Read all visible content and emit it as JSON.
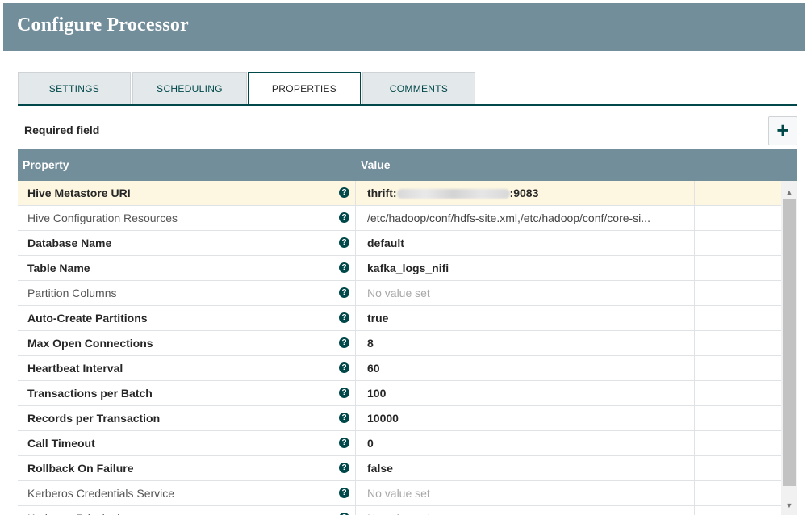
{
  "window": {
    "title": "Configure Processor"
  },
  "tabs": [
    {
      "label": "SETTINGS"
    },
    {
      "label": "SCHEDULING"
    },
    {
      "label": "PROPERTIES"
    },
    {
      "label": "COMMENTS"
    }
  ],
  "active_tab": "PROPERTIES",
  "required_label": "Required field",
  "add_button": {
    "label": "+"
  },
  "table": {
    "headers": {
      "property": "Property",
      "value": "Value"
    },
    "rows": [
      {
        "name": "Hive Metastore URI",
        "required": true,
        "value_prefix": "thrift:",
        "value_suffix": ":9083",
        "value_state": "set"
      },
      {
        "name": "Hive Configuration Resources",
        "required": false,
        "value": "/etc/hadoop/conf/hdfs-site.xml,/etc/hadoop/conf/core-si...",
        "value_state": "set"
      },
      {
        "name": "Database Name",
        "required": true,
        "value": "default",
        "value_state": "set"
      },
      {
        "name": "Table Name",
        "required": true,
        "value": "kafka_logs_nifi",
        "value_state": "set"
      },
      {
        "name": "Partition Columns",
        "required": false,
        "value": "No value set",
        "value_state": "empty"
      },
      {
        "name": "Auto-Create Partitions",
        "required": true,
        "value": "true",
        "value_state": "set"
      },
      {
        "name": "Max Open Connections",
        "required": true,
        "value": "8",
        "value_state": "set"
      },
      {
        "name": "Heartbeat Interval",
        "required": true,
        "value": "60",
        "value_state": "set"
      },
      {
        "name": "Transactions per Batch",
        "required": true,
        "value": "100",
        "value_state": "set"
      },
      {
        "name": "Records per Transaction",
        "required": true,
        "value": "10000",
        "value_state": "set"
      },
      {
        "name": "Call Timeout",
        "required": true,
        "value": "0",
        "value_state": "set"
      },
      {
        "name": "Rollback On Failure",
        "required": true,
        "value": "false",
        "value_state": "set"
      },
      {
        "name": "Kerberos Credentials Service",
        "required": false,
        "value": "No value set",
        "value_state": "empty"
      },
      {
        "name": "Kerberos Principal",
        "required": false,
        "value": "No value set",
        "value_state": "empty"
      }
    ]
  },
  "help_icon": "question-circle-icon",
  "colors": {
    "header": "#728e9b",
    "accent": "#004849",
    "selected_row": "#fdf7e1"
  }
}
